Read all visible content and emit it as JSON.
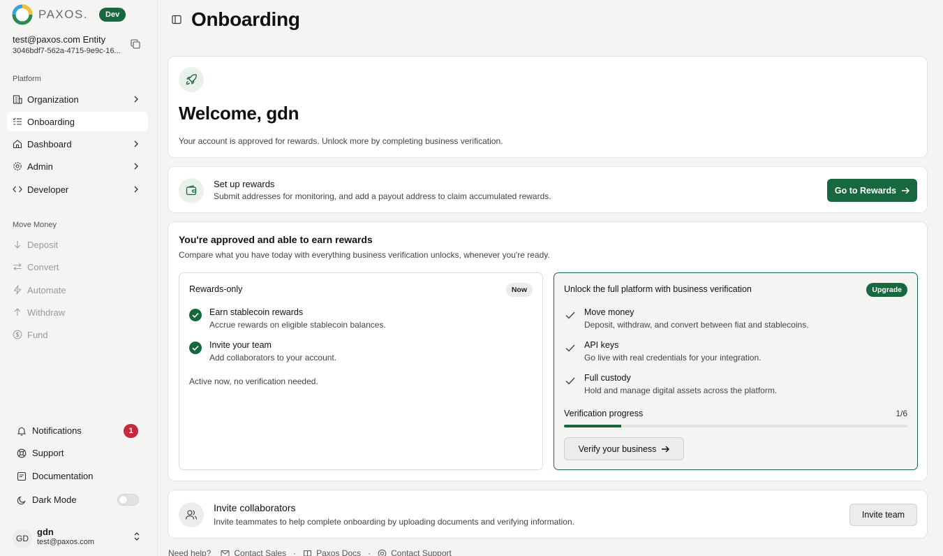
{
  "brand": {
    "name": "PAXOS.",
    "env_badge": "Dev"
  },
  "entity": {
    "name": "test@paxos.com Entity",
    "id": "3046bdf7-562a-4715-9e9c-16..."
  },
  "sidebar": {
    "platform_label": "Platform",
    "platform_items": [
      {
        "label": "Organization",
        "icon": "building-icon"
      },
      {
        "label": "Onboarding",
        "icon": "list-check-icon",
        "active": true
      },
      {
        "label": "Dashboard",
        "icon": "home-icon"
      },
      {
        "label": "Admin",
        "icon": "gear-icon"
      },
      {
        "label": "Developer",
        "icon": "code-icon"
      }
    ],
    "move_money_label": "Move Money",
    "move_money_items": [
      {
        "label": "Deposit",
        "icon": "arrow-down-icon"
      },
      {
        "label": "Convert",
        "icon": "swap-icon"
      },
      {
        "label": "Automate",
        "icon": "bolt-icon"
      },
      {
        "label": "Withdraw",
        "icon": "arrow-up-icon"
      },
      {
        "label": "Fund",
        "icon": "dollar-icon"
      }
    ],
    "notifications": {
      "label": "Notifications",
      "count": "1"
    },
    "support": "Support",
    "documentation": "Documentation",
    "dark_mode": "Dark Mode",
    "user": {
      "initials": "GD",
      "name": "gdn",
      "email": "test@paxos.com"
    }
  },
  "main": {
    "title": "Onboarding",
    "welcome": {
      "title": "Welcome, gdn",
      "subtitle": "Your account is approved for rewards. Unlock more by completing business verification."
    },
    "rewards": {
      "title": "Set up rewards",
      "subtitle": "Submit addresses for monitoring, and add a payout address to claim accumulated rewards.",
      "button": "Go to Rewards"
    },
    "approved": {
      "title": "You're approved and able to earn rewards",
      "subtitle": "Compare what you have today with everything business verification unlocks, whenever you're ready.",
      "left": {
        "title": "Rewards-only",
        "badge": "Now",
        "features": [
          {
            "title": "Earn stablecoin rewards",
            "desc": "Accrue rewards on eligible stablecoin balances."
          },
          {
            "title": "Invite your team",
            "desc": "Add collaborators to your account."
          }
        ],
        "note": "Active now, no verification needed."
      },
      "right": {
        "title": "Unlock the full platform with business verification",
        "badge": "Upgrade",
        "features": [
          {
            "title": "Move money",
            "desc": "Deposit, withdraw, and convert between fiat and stablecoins."
          },
          {
            "title": "API keys",
            "desc": "Go live with real credentials for your integration."
          },
          {
            "title": "Full custody",
            "desc": "Hold and manage digital assets across the platform."
          }
        ],
        "progress_label": "Verification progress",
        "progress_text": "1/6",
        "progress_fraction": 0.1667,
        "button": "Verify your business"
      }
    },
    "invite": {
      "title": "Invite collaborators",
      "subtitle": "Invite teammates to help complete onboarding by uploading documents and verifying information.",
      "button": "Invite team"
    },
    "footer": {
      "help": "Need help?",
      "links": [
        "Contact Sales",
        "Paxos Docs",
        "Contact Support"
      ],
      "separator": "·"
    }
  },
  "colors": {
    "accent": "#17673f",
    "badge_red": "#c42a3b",
    "background": "#f4f4f3"
  }
}
